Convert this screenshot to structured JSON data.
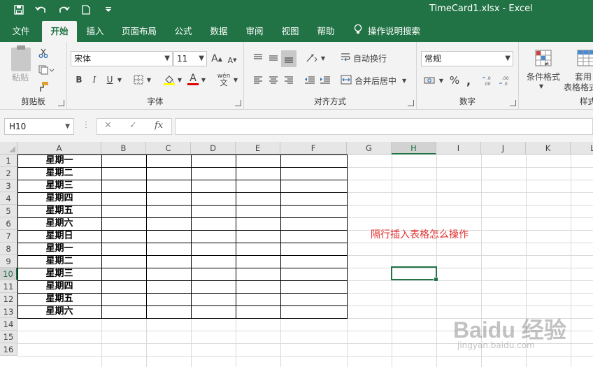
{
  "titlebar": {
    "title": "TimeCard1.xlsx  -  Excel",
    "qat": [
      "save-icon",
      "undo-icon",
      "redo-icon",
      "new-icon",
      "customize-icon"
    ]
  },
  "tabs": [
    {
      "label": "文件"
    },
    {
      "label": "开始"
    },
    {
      "label": "插入"
    },
    {
      "label": "页面布局"
    },
    {
      "label": "公式"
    },
    {
      "label": "数据"
    },
    {
      "label": "审阅"
    },
    {
      "label": "视图"
    },
    {
      "label": "帮助"
    }
  ],
  "active_tab": "开始",
  "tell_me": "操作说明搜索",
  "ribbon": {
    "clipboard": {
      "label": "剪贴板",
      "paste": "粘贴"
    },
    "font": {
      "label": "字体",
      "font_name": "宋体",
      "font_size": "11",
      "grow": "A",
      "shrink": "A",
      "bold": "B",
      "italic": "I",
      "underline": "U",
      "font_color_letter": "A",
      "pinyin": "wén"
    },
    "alignment": {
      "label": "对齐方式",
      "wrap": "自动换行",
      "merge": "合并后居中"
    },
    "number": {
      "label": "数字",
      "format": "常规",
      "percent": "%",
      "comma": ","
    },
    "styles": {
      "label": "样式",
      "conditional": "条件格式",
      "table1": "套用",
      "table2": "表格格式"
    }
  },
  "formula_bar": {
    "name_box": "H10",
    "value": "",
    "fx": "fx"
  },
  "columns": [
    "A",
    "B",
    "C",
    "D",
    "E",
    "F",
    "G",
    "H",
    "I",
    "J",
    "K",
    "L"
  ],
  "selected_column": "H",
  "rows": [
    "1",
    "2",
    "3",
    "4",
    "5",
    "6",
    "7",
    "8",
    "9",
    "10",
    "11",
    "12",
    "13",
    "14",
    "15",
    "16"
  ],
  "selected_row": "10",
  "cells_A": [
    "星期一",
    "星期二",
    "星期三",
    "星期四",
    "星期五",
    "星期六",
    "星期日",
    "星期一",
    "星期二",
    "星期三",
    "星期四",
    "星期五",
    "星期六"
  ],
  "note": "隔行插入表格怎么操作",
  "watermark": {
    "logo": "Baidu 经验",
    "url": "jingyan.baidu.com"
  }
}
